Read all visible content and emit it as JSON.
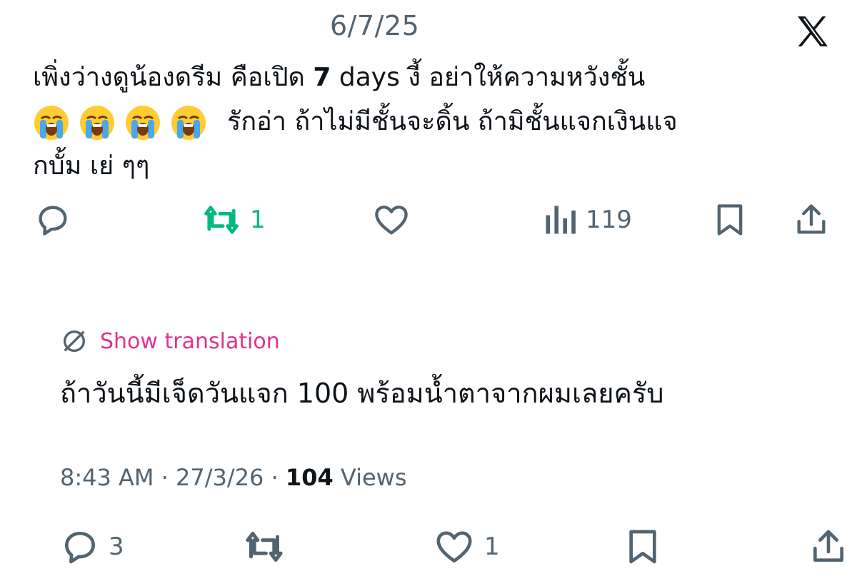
{
  "header": {
    "date": "6/7/25",
    "logo_icon": "x-logo-icon"
  },
  "tweet": {
    "line1_part1": "เพิ่งว่างดูน้องดรีม คือเปิด ",
    "line1_bold": "7",
    "line1_part2": " days งี้ อย่าให้ความหวังชั้น",
    "emoji_name": "loudly-crying-face-icon",
    "emoji_count": 4,
    "line2_text": "รักอ่า ถ้าไม่มีชั้นจะดิ้น ถ้ามิชั้นแจกเงินแจ",
    "line3_text": "กบั้ม เย่ ๆๆ",
    "actions": {
      "reply_icon": "reply-icon",
      "retweet_icon": "retweet-icon",
      "retweet_count": "1",
      "like_icon": "heart-icon",
      "views_icon": "analytics-icon",
      "views_count": "119",
      "bookmark_icon": "bookmark-icon",
      "share_icon": "share-icon"
    },
    "retweet_color": "#00ba7c"
  },
  "reply": {
    "translate_icon": "globe-icon",
    "translate_label": "Show translation",
    "translate_color": "#e0338f",
    "text": "ถ้าวันนี้มีเจ็ดวันแจก 100 พร้อมน้ำตาจากผมเลยครับ",
    "time": "8:43 AM",
    "sep1": " · ",
    "date": "27/3/26",
    "sep2": " · ",
    "views_count": "104",
    "views_label": " Views",
    "actions": {
      "reply_count": "3",
      "like_count": "1"
    }
  }
}
